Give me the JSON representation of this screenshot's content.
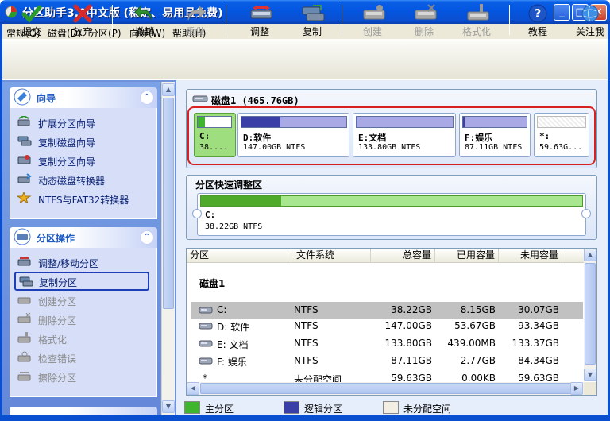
{
  "window": {
    "title": "分区助手3.0中文版 (稳定、易用且免费)",
    "minimize": "_",
    "maximize": "□",
    "close": "✕"
  },
  "menu": [
    "常规(G)",
    "磁盘(D)",
    "分区(P)",
    "向导(W)",
    "帮助(H)"
  ],
  "toolbar": {
    "submit": "提交",
    "discard": "放弃",
    "undo": "撤销",
    "redo": "重做",
    "resize": "调整",
    "copy": "复制",
    "create": "创建",
    "delete": "删除",
    "format": "格式化",
    "tutorial": "教程",
    "follow": "关注我"
  },
  "wizard_group": {
    "title": "向导",
    "items": [
      "扩展分区向导",
      "复制磁盘向导",
      "复制分区向导",
      "动态磁盘转换器",
      "NTFS与FAT32转换器"
    ]
  },
  "ops_group": {
    "title": "分区操作",
    "items": [
      "调整/移动分区",
      "复制分区",
      "创建分区",
      "删除分区",
      "格式化",
      "检查错误",
      "擦除分区"
    ]
  },
  "disk": {
    "label": "磁盘1 (465.76GB)",
    "partitions": [
      {
        "name": "C:",
        "sub": "38....",
        "color": "#3fb52f",
        "fill": 0.21
      },
      {
        "name": "D:软件",
        "sub": "147.00GB NTFS",
        "color": "#3a3fa8",
        "fill": 0.37
      },
      {
        "name": "E:文档",
        "sub": "133.80GB NTFS",
        "color": "#3a3fa8",
        "fill": 0.01
      },
      {
        "name": "F:娱乐",
        "sub": "87.11GB NTFS",
        "color": "#3a3fa8",
        "fill": 0.03
      },
      {
        "name": "*:",
        "sub": "59.63G...",
        "color": "#d8d8d8",
        "fill": 0
      }
    ]
  },
  "quick": {
    "title": "分区快速调整区",
    "name": "C:",
    "size": "38.22GB NTFS",
    "fill": 0.21
  },
  "list": {
    "columns": [
      "分区",
      "文件系统",
      "总容量",
      "已用容量",
      "未用容量"
    ],
    "disk_label": "磁盘1",
    "rows": [
      {
        "part": "C:",
        "fs": "NTFS",
        "total": "38.22GB",
        "used": "8.15GB",
        "free": "30.07GB"
      },
      {
        "part": "D: 软件",
        "fs": "NTFS",
        "total": "147.00GB",
        "used": "53.67GB",
        "free": "93.34GB"
      },
      {
        "part": "E: 文档",
        "fs": "NTFS",
        "total": "133.80GB",
        "used": "439.00MB",
        "free": "133.37GB"
      },
      {
        "part": "F: 娱乐",
        "fs": "NTFS",
        "total": "87.11GB",
        "used": "2.77GB",
        "free": "84.34GB"
      },
      {
        "part": "*",
        "fs": "未分配空间",
        "total": "59.63GB",
        "used": "0.00KB",
        "free": "59.63GB"
      }
    ]
  },
  "legend": {
    "primary": "主分区",
    "logical": "逻辑分区",
    "unallocated": "未分配空间"
  },
  "colors": {
    "primary": "#3fb52f",
    "logical": "#3a3fa8",
    "unallocated": "#f3eee3",
    "selection_border": "#d92020"
  }
}
